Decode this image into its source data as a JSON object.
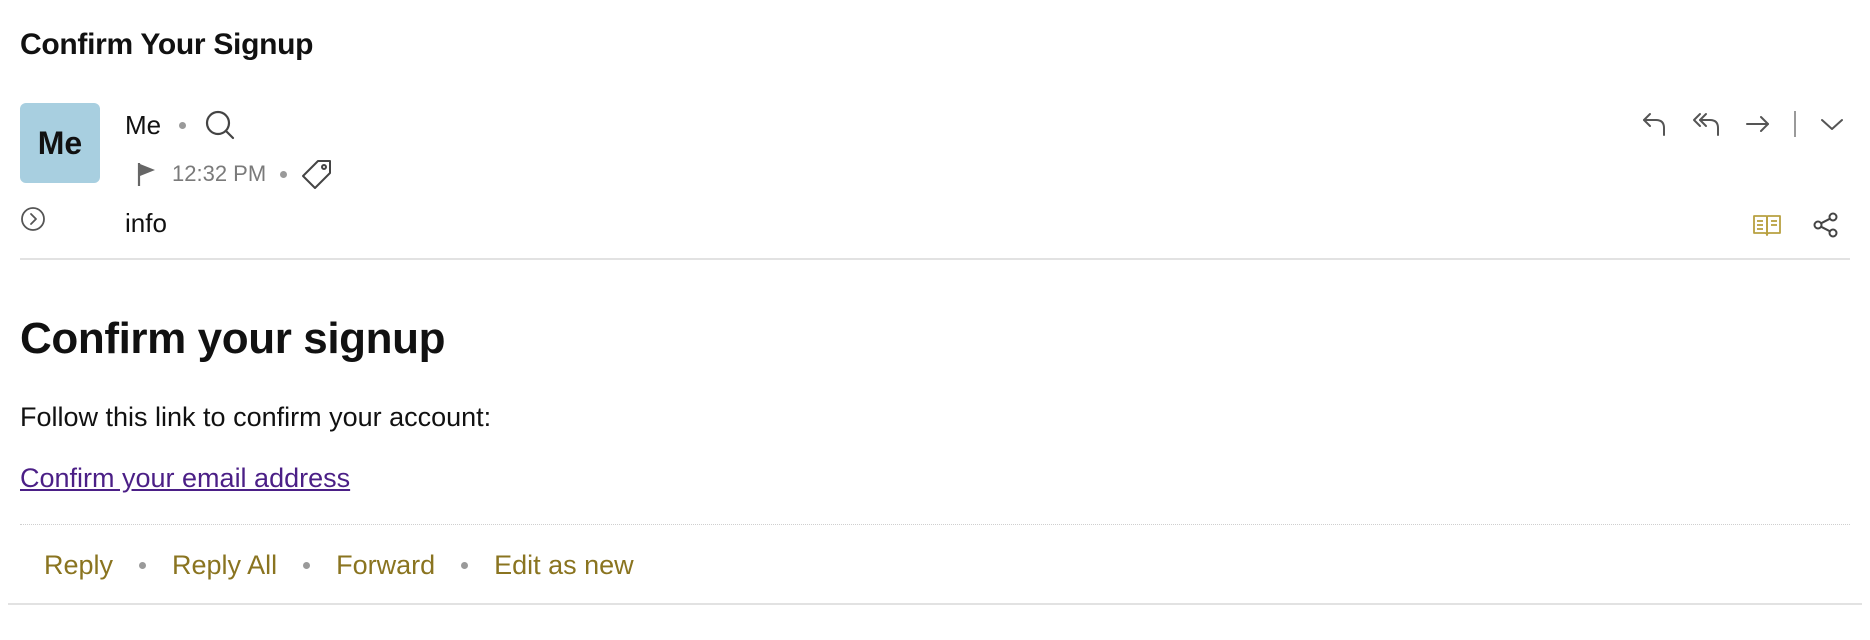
{
  "message": {
    "subject": "Confirm Your Signup",
    "avatar_initials": "Me",
    "sender_name": "Me",
    "time": "12:32 PM",
    "recipient": "info"
  },
  "header_actions": [
    {
      "icon": "reply-icon"
    },
    {
      "icon": "reply-all-icon"
    },
    {
      "icon": "forward-icon"
    },
    {
      "icon": "more-chevron-down-icon"
    }
  ],
  "body": {
    "heading": "Confirm your signup",
    "text": "Follow this link to confirm your account:",
    "link_label": "Confirm your email address"
  },
  "footer": {
    "reply": "Reply",
    "reply_all": "Reply All",
    "forward": "Forward",
    "edit_as_new": "Edit as new"
  },
  "colors": {
    "avatar_bg": "#a8cfe0",
    "link": "#4b1f86",
    "action_text": "#8a7420",
    "reader_icon": "#b8a040",
    "icon_gray": "#5a5a5a"
  }
}
